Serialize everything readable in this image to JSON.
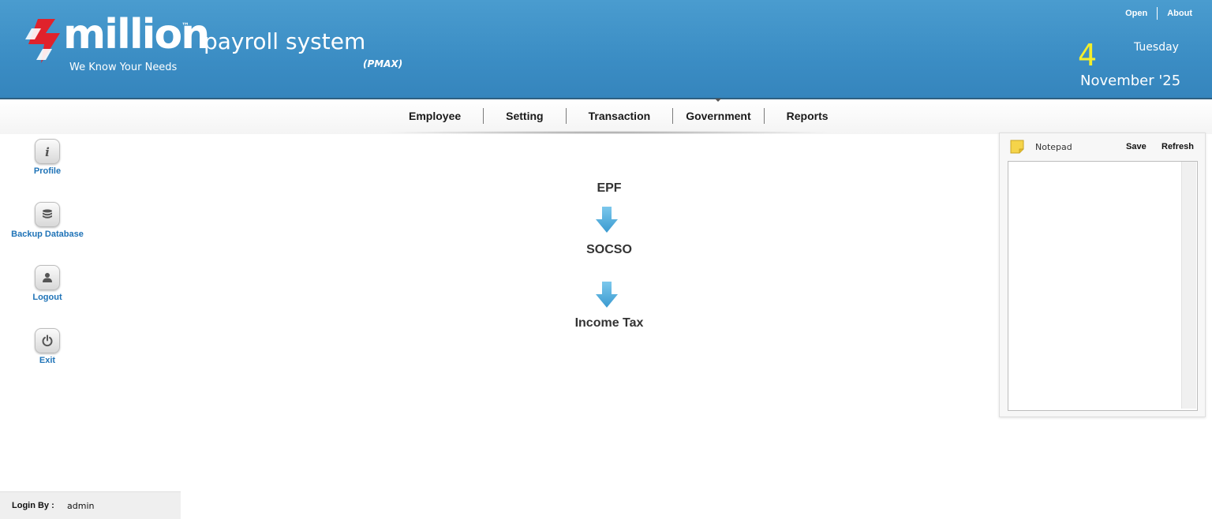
{
  "header": {
    "logo_word": "million",
    "logo_tm": "™",
    "tagline": "We Know Your Needs",
    "app_name": "payroll system",
    "app_code": "(PMAX)",
    "top_links": {
      "open": "Open",
      "about": "About"
    },
    "date": {
      "day": "4",
      "weekday": "Tuesday",
      "month_year": "November '25"
    },
    "colors": {
      "brand_red": "#e0222b",
      "header_blue": "#3b8dc4",
      "date_yellow": "#f3ee2b"
    }
  },
  "nav": {
    "items": [
      "Employee",
      "Setting",
      "Transaction",
      "Government",
      "Reports"
    ],
    "active_index": 3
  },
  "sidebar": {
    "items": [
      {
        "label": "Profile",
        "icon": "info-icon"
      },
      {
        "label": "Backup Database",
        "icon": "database-icon"
      },
      {
        "label": "Logout",
        "icon": "user-icon"
      },
      {
        "label": "Exit",
        "icon": "power-icon"
      }
    ]
  },
  "flow": {
    "steps": [
      "EPF",
      "SOCSO",
      "Income Tax"
    ],
    "arrow_color": "#4aa9d9"
  },
  "notepad": {
    "title": "Notepad",
    "save_label": "Save",
    "refresh_label": "Refresh",
    "content": ""
  },
  "footer": {
    "login_label": "Login By :",
    "login_user": "admin"
  }
}
